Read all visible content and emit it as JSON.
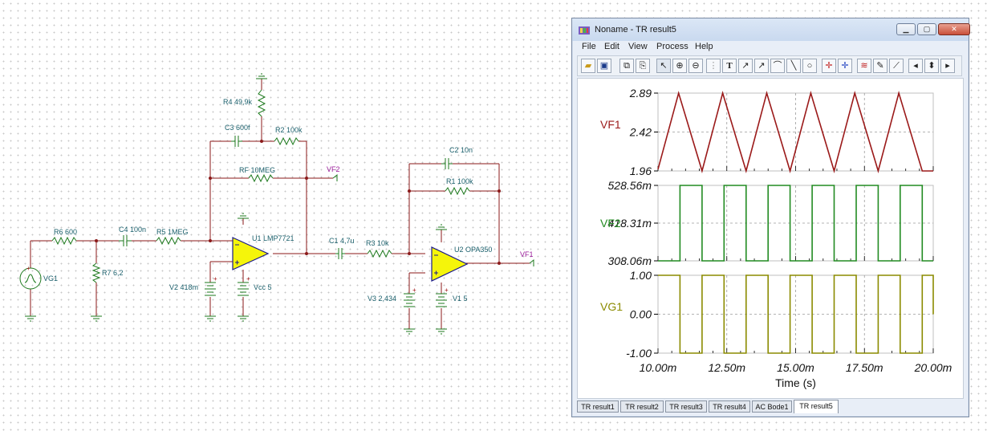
{
  "schematic": {
    "components": {
      "r6": "R6 600",
      "r7": "R7 6,2",
      "c4": "C4 100n",
      "r5": "R5 1MEG",
      "r4": "R4 49,9k",
      "c3": "C3 600f",
      "r2": "R2 100k",
      "rf": "RF 10MEG",
      "u1": "U1 LMP7721",
      "v2": "V2 418m",
      "vcc": "Vcc 5",
      "c1": "C1 4,7u",
      "r3": "R3 10k",
      "c2": "C2 10n",
      "r1": "R1 100k",
      "u2": "U2 OPA350",
      "v3": "V3 2,434",
      "v1": "V1 5",
      "vg1": "VG1"
    },
    "nets": {
      "vf2": "VF2",
      "vf1": "VF1"
    }
  },
  "window": {
    "title": "Noname - TR result5",
    "menu": [
      "File",
      "Edit",
      "View",
      "Process",
      "Help"
    ],
    "tabs": [
      "TR result1",
      "TR result2",
      "TR result3",
      "TR result4",
      "AC Bode1",
      "TR result5"
    ],
    "active_tab": 5
  },
  "chart_data": {
    "type": "line",
    "xlabel": "Time (s)",
    "x_ticks": [
      "10.00m",
      "12.50m",
      "15.00m",
      "17.50m",
      "20.00m"
    ],
    "xlim": [
      0.01,
      0.02
    ],
    "panels": [
      {
        "name": "VF1",
        "color": "#9b1a1a",
        "y_ticks": [
          "2.89",
          "2.42",
          "1.96"
        ],
        "ylim": [
          1.96,
          2.89
        ],
        "x": [
          0.01,
          0.01075,
          0.0116,
          0.01235,
          0.0132,
          0.01395,
          0.0148,
          0.01555,
          0.0164,
          0.01715,
          0.018,
          0.01875,
          0.0196,
          0.02
        ],
        "y": [
          1.98,
          2.89,
          1.96,
          2.89,
          1.96,
          2.89,
          1.96,
          2.89,
          1.96,
          2.89,
          1.96,
          2.89,
          1.96,
          1.96
        ]
      },
      {
        "name": "VF2",
        "color": "#228b22",
        "y_ticks": [
          "528.56m",
          "418.31m",
          "308.06m"
        ],
        "ylim": [
          308.06,
          528.56
        ],
        "x": [
          0.01,
          0.0108,
          0.0108,
          0.0116,
          0.0116,
          0.0124,
          0.0124,
          0.0132,
          0.0132,
          0.014,
          0.014,
          0.0148,
          0.0148,
          0.0156,
          0.0156,
          0.0164,
          0.0164,
          0.0172,
          0.0172,
          0.018,
          0.018,
          0.0188,
          0.0188,
          0.0196,
          0.0196,
          0.02
        ],
        "y": [
          308.06,
          308.06,
          528.56,
          528.56,
          308.06,
          308.06,
          528.56,
          528.56,
          308.06,
          308.06,
          528.56,
          528.56,
          308.06,
          308.06,
          528.56,
          528.56,
          308.06,
          308.06,
          528.56,
          528.56,
          308.06,
          308.06,
          528.56,
          528.56,
          308.06,
          308.06
        ]
      },
      {
        "name": "VG1",
        "color": "#8b8b00",
        "y_ticks": [
          "1.00",
          "0.00",
          "-1.00"
        ],
        "ylim": [
          -1.0,
          1.0
        ],
        "x": [
          0.01,
          0.0108,
          0.0108,
          0.0116,
          0.0116,
          0.0124,
          0.0124,
          0.0132,
          0.0132,
          0.014,
          0.014,
          0.0148,
          0.0148,
          0.0156,
          0.0156,
          0.0164,
          0.0164,
          0.0172,
          0.0172,
          0.018,
          0.018,
          0.0188,
          0.0188,
          0.0196,
          0.0196,
          0.02,
          0.02
        ],
        "y": [
          1.0,
          1.0,
          -1.0,
          -1.0,
          1.0,
          1.0,
          -1.0,
          -1.0,
          1.0,
          1.0,
          -1.0,
          -1.0,
          1.0,
          1.0,
          -1.0,
          -1.0,
          1.0,
          1.0,
          -1.0,
          -1.0,
          1.0,
          1.0,
          -1.0,
          -1.0,
          1.0,
          1.0,
          0.0
        ]
      }
    ]
  }
}
